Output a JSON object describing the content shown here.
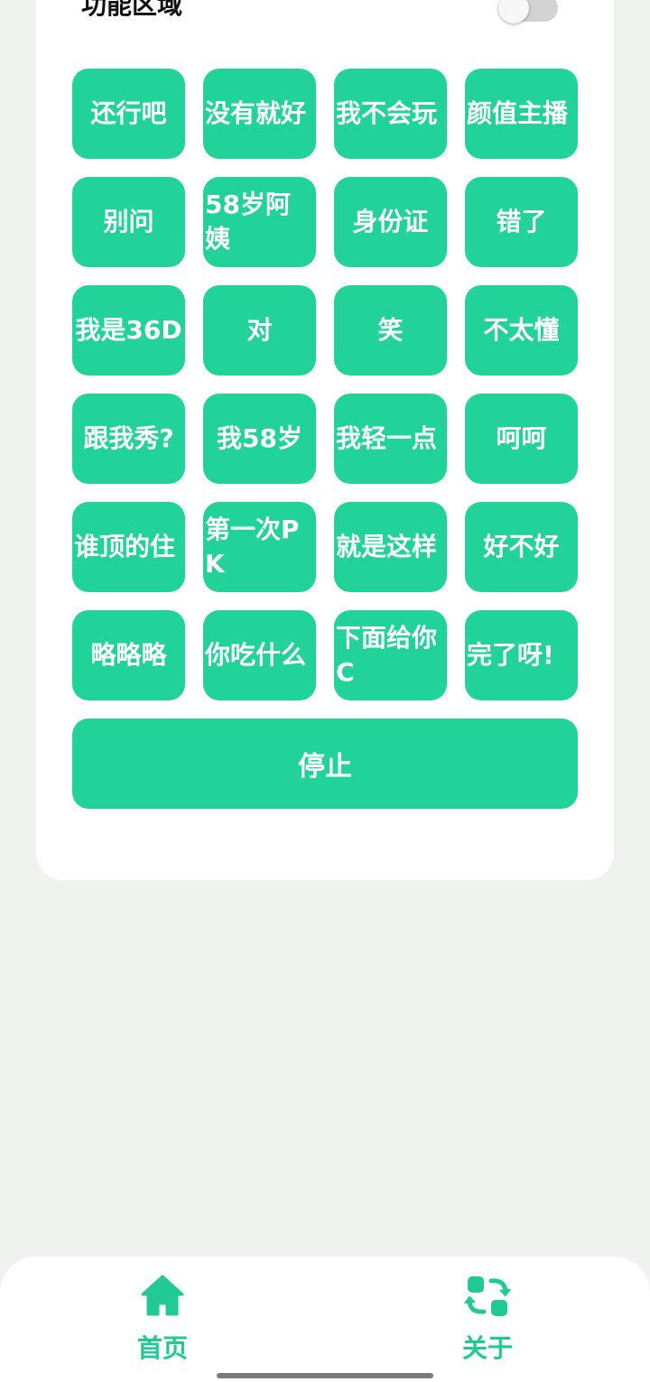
{
  "section": {
    "title": "功能区域",
    "toggle_on": false
  },
  "buttons": [
    {
      "label": "还行吧",
      "wrap": false
    },
    {
      "label": "没有就好",
      "wrap": true
    },
    {
      "label": "我不会玩",
      "wrap": true
    },
    {
      "label": "颜值主播",
      "wrap": true
    },
    {
      "label": "别问",
      "wrap": false
    },
    {
      "label": "58岁阿姨",
      "wrap": true
    },
    {
      "label": "身份证",
      "wrap": false
    },
    {
      "label": "错了",
      "wrap": false
    },
    {
      "label": "我是36D",
      "wrap": false
    },
    {
      "label": "对",
      "wrap": false
    },
    {
      "label": "笑",
      "wrap": false
    },
    {
      "label": "不太懂",
      "wrap": false
    },
    {
      "label": "跟我秀?",
      "wrap": false
    },
    {
      "label": "我58岁",
      "wrap": false
    },
    {
      "label": "我轻一点",
      "wrap": true
    },
    {
      "label": "呵呵",
      "wrap": false
    },
    {
      "label": "谁顶的住",
      "wrap": true
    },
    {
      "label": "第一次PK",
      "wrap": true
    },
    {
      "label": "就是这样",
      "wrap": true
    },
    {
      "label": "好不好",
      "wrap": false
    },
    {
      "label": "略略略",
      "wrap": false
    },
    {
      "label": "你吃什么",
      "wrap": true
    },
    {
      "label": "下面给你C",
      "wrap": true
    },
    {
      "label": "完了呀!",
      "wrap": true
    }
  ],
  "stop": {
    "label": "停止"
  },
  "nav": {
    "home": {
      "label": "首页",
      "icon": "home-icon"
    },
    "about": {
      "label": "关于",
      "icon": "swap-icon"
    }
  },
  "colors": {
    "accent": "#22d399",
    "nav_text": "#22c992",
    "background": "#f0f2ef"
  }
}
